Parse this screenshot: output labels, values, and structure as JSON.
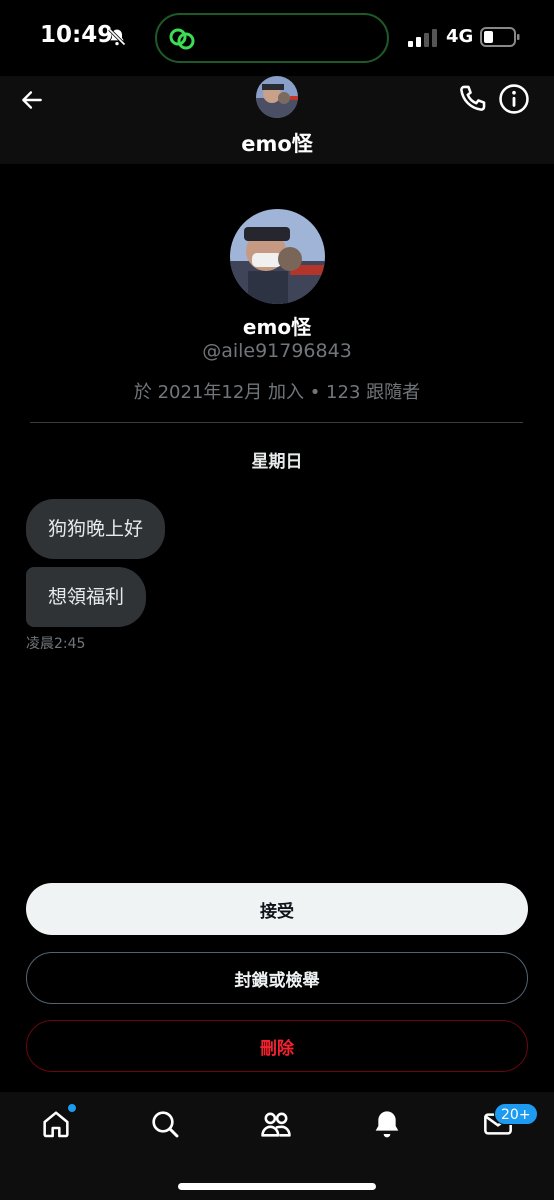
{
  "status_bar": {
    "time": "10:49",
    "network": "4G"
  },
  "header": {
    "name": "emo怪"
  },
  "profile": {
    "name": "emo怪",
    "handle": "@aile91796843",
    "meta": "於 2021年12月 加入 • 123 跟隨者"
  },
  "conversation": {
    "day_label": "星期日",
    "messages": [
      {
        "text": "狗狗晚上好"
      },
      {
        "text": "想領福利"
      }
    ],
    "time": "凌晨2:45"
  },
  "actions": {
    "accept": "接受",
    "block_report": "封鎖或檢舉",
    "delete": "刪除"
  },
  "bottom_nav": {
    "messages_badge": "20+"
  },
  "colors": {
    "accent": "#1d9bf0",
    "danger": "#f4212e",
    "background": "#000000",
    "bubble": "#2f3336"
  }
}
